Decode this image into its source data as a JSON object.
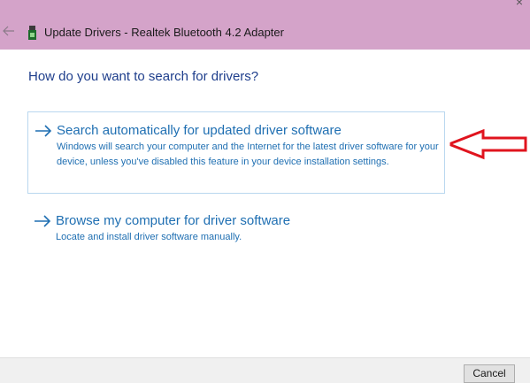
{
  "window": {
    "title": "Update Drivers - Realtek Bluetooth 4.2 Adapter",
    "close_glyph": "×",
    "icons": {
      "back": "back-arrow-icon",
      "device": "bluetooth-adapter-icon",
      "close": "close-icon"
    },
    "titlebar_color": "#d4a3c9"
  },
  "page": {
    "heading": "How do you want to search for drivers?"
  },
  "options": [
    {
      "title": "Search automatically for updated driver software",
      "description": "Windows will search your computer and the Internet for the latest driver software for your device, unless you've disabled this feature in your device installation settings."
    },
    {
      "title": "Browse my computer for driver software",
      "description": "Locate and install driver software manually."
    }
  ],
  "footer": {
    "cancel_label": "Cancel"
  },
  "colors": {
    "heading": "#1e3e8c",
    "link": "#1f6fb2",
    "annotation_arrow": "#e0141e"
  }
}
